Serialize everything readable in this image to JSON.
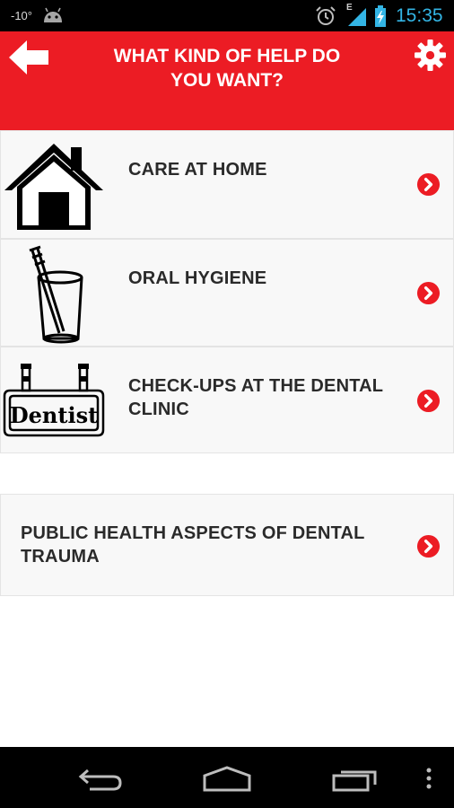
{
  "status_bar": {
    "temperature": "-10°",
    "network_type": "E",
    "time": "15:35"
  },
  "header": {
    "title": "WHAT KIND OF HELP DO YOU WANT?",
    "back_icon": "back-arrow-icon",
    "settings_icon": "gear-icon"
  },
  "menu": {
    "items": [
      {
        "label": "CARE AT HOME",
        "icon": "house-icon"
      },
      {
        "label": "ORAL HYGIENE",
        "icon": "toothbrush-glass-icon"
      },
      {
        "label": "CHECK-UPS AT THE DENTAL CLINIC",
        "icon": "dentist-sign-icon",
        "sign_text": "Dentist"
      },
      {
        "label": "PUBLIC HEALTH ASPECTS OF DENTAL TRAUMA"
      }
    ]
  },
  "colors": {
    "accent": "#ec1c24",
    "clock": "#33b5e5",
    "text": "#2a2a2a"
  }
}
